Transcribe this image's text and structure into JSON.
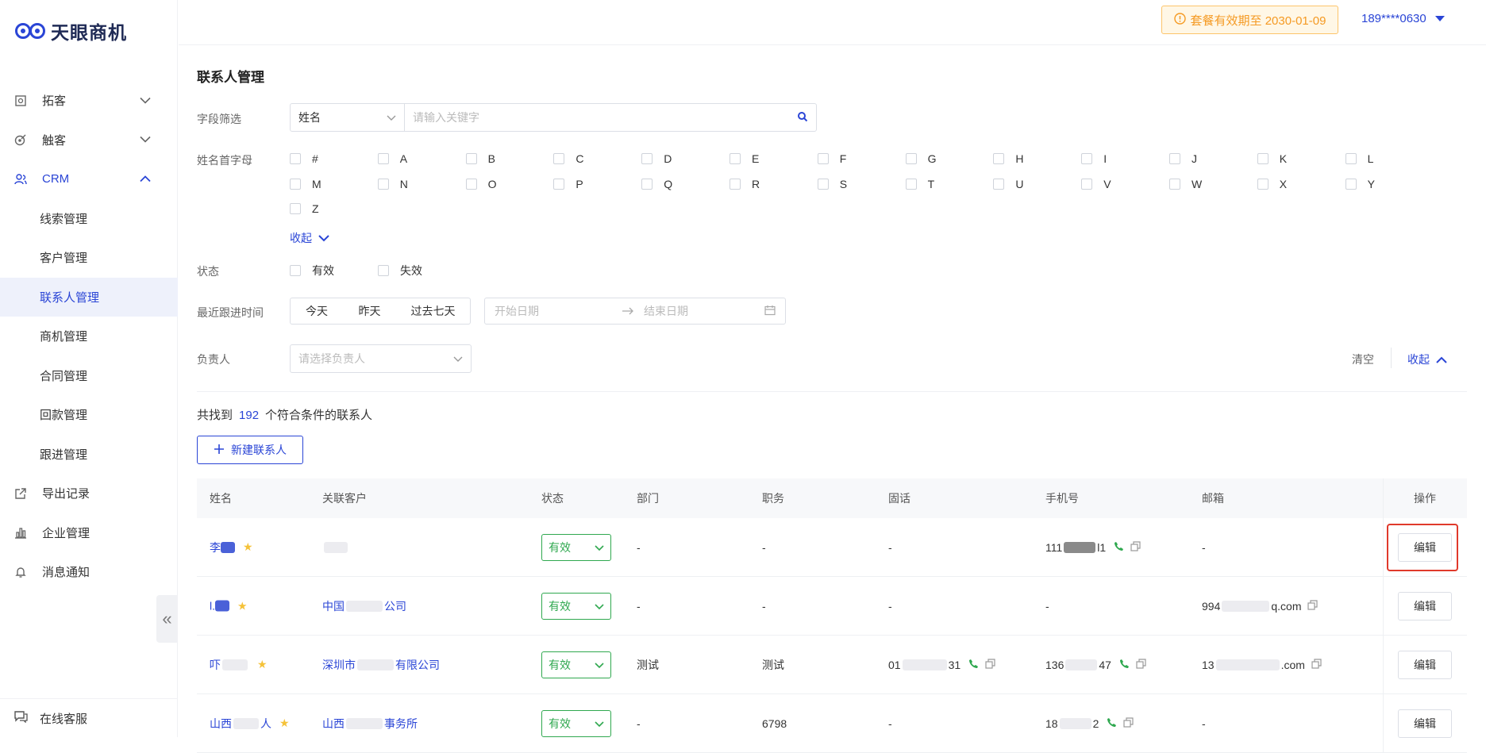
{
  "brand": {
    "name": "天眼商机"
  },
  "sidebar": {
    "items": [
      {
        "label": "拓客",
        "icon": "search-doc-icon"
      },
      {
        "label": "触客",
        "icon": "target-icon"
      },
      {
        "label": "CRM",
        "icon": "users-icon"
      }
    ],
    "crm_sub": [
      "线索管理",
      "客户管理",
      "联系人管理",
      "商机管理",
      "合同管理",
      "回款管理",
      "跟进管理"
    ],
    "bottom_items": [
      {
        "label": "导出记录",
        "icon": "export-icon"
      },
      {
        "label": "企业管理",
        "icon": "bar-chart-icon"
      },
      {
        "label": "消息通知",
        "icon": "bell-icon"
      }
    ],
    "service": "在线客服",
    "collapse_glyph": "«"
  },
  "header": {
    "plan": "套餐有效期至 2030-01-09",
    "user": "189****0630"
  },
  "page": {
    "title": "联系人管理",
    "field_filter_label": "字段筛选",
    "field_select": "姓名",
    "keyword_placeholder": "请输入关键字",
    "initial_label": "姓名首字母",
    "letters": [
      "#",
      "A",
      "B",
      "C",
      "D",
      "E",
      "F",
      "G",
      "H",
      "I",
      "J",
      "K",
      "L",
      "M",
      "N",
      "O",
      "P",
      "Q",
      "R",
      "S",
      "T",
      "U",
      "V",
      "W",
      "X",
      "Y",
      "Z"
    ],
    "letters_collapse": "收起",
    "status_label": "状态",
    "status_options": [
      "有效",
      "失效"
    ],
    "recent_label": "最近跟进时间",
    "quick_dates": [
      "今天",
      "昨天",
      "过去七天"
    ],
    "start_placeholder": "开始日期",
    "end_placeholder": "结束日期",
    "owner_label": "负责人",
    "owner_placeholder": "请选择负责人",
    "clear": "清空",
    "collapse": "收起",
    "result_prefix": "共找到",
    "result_count": "192",
    "result_suffix": "个符合条件的联系人",
    "new_button": "新建联系人"
  },
  "table": {
    "headers": [
      "姓名",
      "关联客户",
      "状态",
      "部门",
      "职务",
      "固话",
      "手机号",
      "邮箱",
      "操作"
    ],
    "rows": [
      {
        "name_prefix": "李",
        "name_suffix": "",
        "company_prefix": "",
        "company_suffix": "",
        "status": "有效",
        "dept": "-",
        "title": "-",
        "landline_prefix": "-",
        "landline_suffix": "",
        "mobile_prefix": "111",
        "mobile_suffix": "l1",
        "email_prefix": "-",
        "email_suffix": "",
        "action": "编辑"
      },
      {
        "name_prefix": "l.",
        "name_suffix": "",
        "company_prefix": "中国",
        "company_suffix": "公司",
        "status": "有效",
        "dept": "-",
        "title": "-",
        "landline_prefix": "-",
        "landline_suffix": "",
        "mobile_prefix": "-",
        "mobile_suffix": "",
        "email_prefix": "994",
        "email_suffix": "q.com",
        "action": "编辑"
      },
      {
        "name_prefix": "吓",
        "name_suffix": "",
        "company_prefix": "深圳市",
        "company_suffix": "有限公司",
        "status": "有效",
        "dept": "测试",
        "title": "测试",
        "landline_prefix": "01",
        "landline_suffix": "31",
        "mobile_prefix": "136",
        "mobile_suffix": "47",
        "email_prefix": "13",
        "email_suffix": ".com",
        "action": "编辑"
      },
      {
        "name_prefix": "山西",
        "name_suffix": "人",
        "company_prefix": "山西",
        "company_suffix": "事务所",
        "status": "有效",
        "dept": "-",
        "title": "6798",
        "landline_prefix": "-",
        "landline_suffix": "",
        "mobile_prefix": "18",
        "mobile_suffix": "2",
        "email_prefix": "-",
        "email_suffix": "",
        "action": "编辑"
      }
    ]
  }
}
